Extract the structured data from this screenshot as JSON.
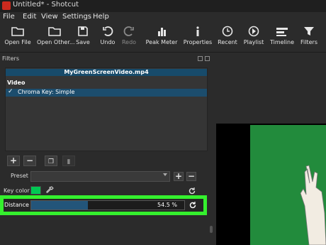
{
  "window": {
    "title": "Untitled* - Shotcut"
  },
  "menu": [
    "File",
    "Edit",
    "View",
    "Settings",
    "Help"
  ],
  "toolbar": {
    "open_file": "Open File",
    "open_other": "Open Other...",
    "save": "Save",
    "undo": "Undo",
    "redo": "Redo",
    "peak_meter": "Peak Meter",
    "properties": "Properties",
    "recent": "Recent",
    "playlist": "Playlist",
    "timeline": "Timeline",
    "filters": "Filters"
  },
  "filters_panel": {
    "title": "Filters",
    "clip_name": "MyGreenScreenVideo.mp4",
    "section": "Video",
    "filter_item": {
      "checked": true,
      "label": "Chroma Key: Simple"
    }
  },
  "preset": {
    "label": "Preset",
    "value": ""
  },
  "key_color": {
    "label": "Key color",
    "swatch": "#00c853"
  },
  "distance": {
    "label": "Distance",
    "value_text": "54.5 %",
    "percent": 54.5
  },
  "highlight_color": "#35f02e",
  "preview": {
    "background": "#228b3c"
  }
}
